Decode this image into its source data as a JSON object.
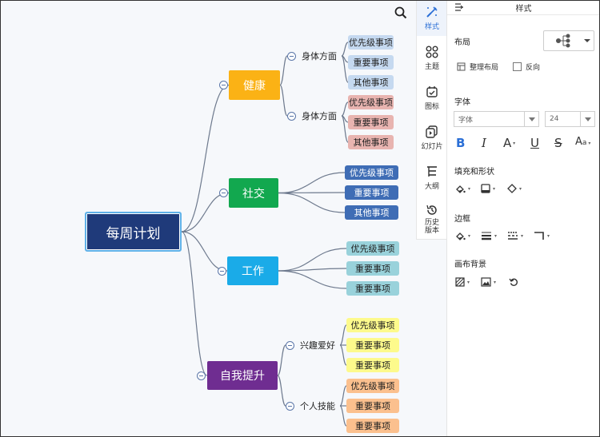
{
  "mindmap": {
    "root": "每周计划",
    "branches": [
      {
        "label": "健康",
        "color": "#fbb215",
        "subs": [
          {
            "label": "身体方面",
            "leaves": [
              "优先级事项",
              "重要事项",
              "其他事项"
            ],
            "leaf_color": "#c5d9f0"
          },
          {
            "label": "身体方面",
            "leaves": [
              "优先级事项",
              "重要事项",
              "其他事项"
            ],
            "leaf_color": "#e8b4b0"
          }
        ]
      },
      {
        "label": "社交",
        "color": "#12a84f",
        "leaves": [
          "优先级事项",
          "重要事项",
          "其他事项"
        ],
        "leaf_color": "#3f6db5",
        "leaf_text_color": "#ffffff"
      },
      {
        "label": "工作",
        "color": "#1aabe8",
        "leaves": [
          "优先级事项",
          "重要事项",
          "重要事项"
        ],
        "leaf_color": "#99d2db"
      },
      {
        "label": "自我提升",
        "color": "#6f2d91",
        "subs": [
          {
            "label": "兴趣爱好",
            "leaves": [
              "优先级事项",
              "重要事项",
              "重要事项"
            ],
            "leaf_color": "#fdfa8c"
          },
          {
            "label": "个人技能",
            "leaves": [
              "优先级事项",
              "重要事项",
              "重要事项"
            ],
            "leaf_color": "#fbc08e"
          }
        ]
      }
    ]
  },
  "vertical_tabs": [
    {
      "label": "样式",
      "icon": "style-brush-icon",
      "active": true
    },
    {
      "label": "主题",
      "icon": "theme-grid-icon",
      "active": false
    },
    {
      "label": "图标",
      "icon": "icon-calendar-icon",
      "active": false
    },
    {
      "label": "幻灯片",
      "icon": "slideshow-icon",
      "active": false
    },
    {
      "label": "大纲",
      "icon": "outline-icon",
      "active": false
    },
    {
      "label": "历史版本",
      "icon": "history-icon",
      "active": false
    }
  ],
  "panel": {
    "title": "样式",
    "layout_label": "布局",
    "tidy_label": "整理布局",
    "reverse_label": "反向",
    "font_label": "字体",
    "font_family_placeholder": "字体",
    "font_size_value": "24",
    "fill_shape_label": "填充和形状",
    "border_label": "边框",
    "canvas_bg_label": "画布背景",
    "accent_color": "#2b6fd6"
  }
}
